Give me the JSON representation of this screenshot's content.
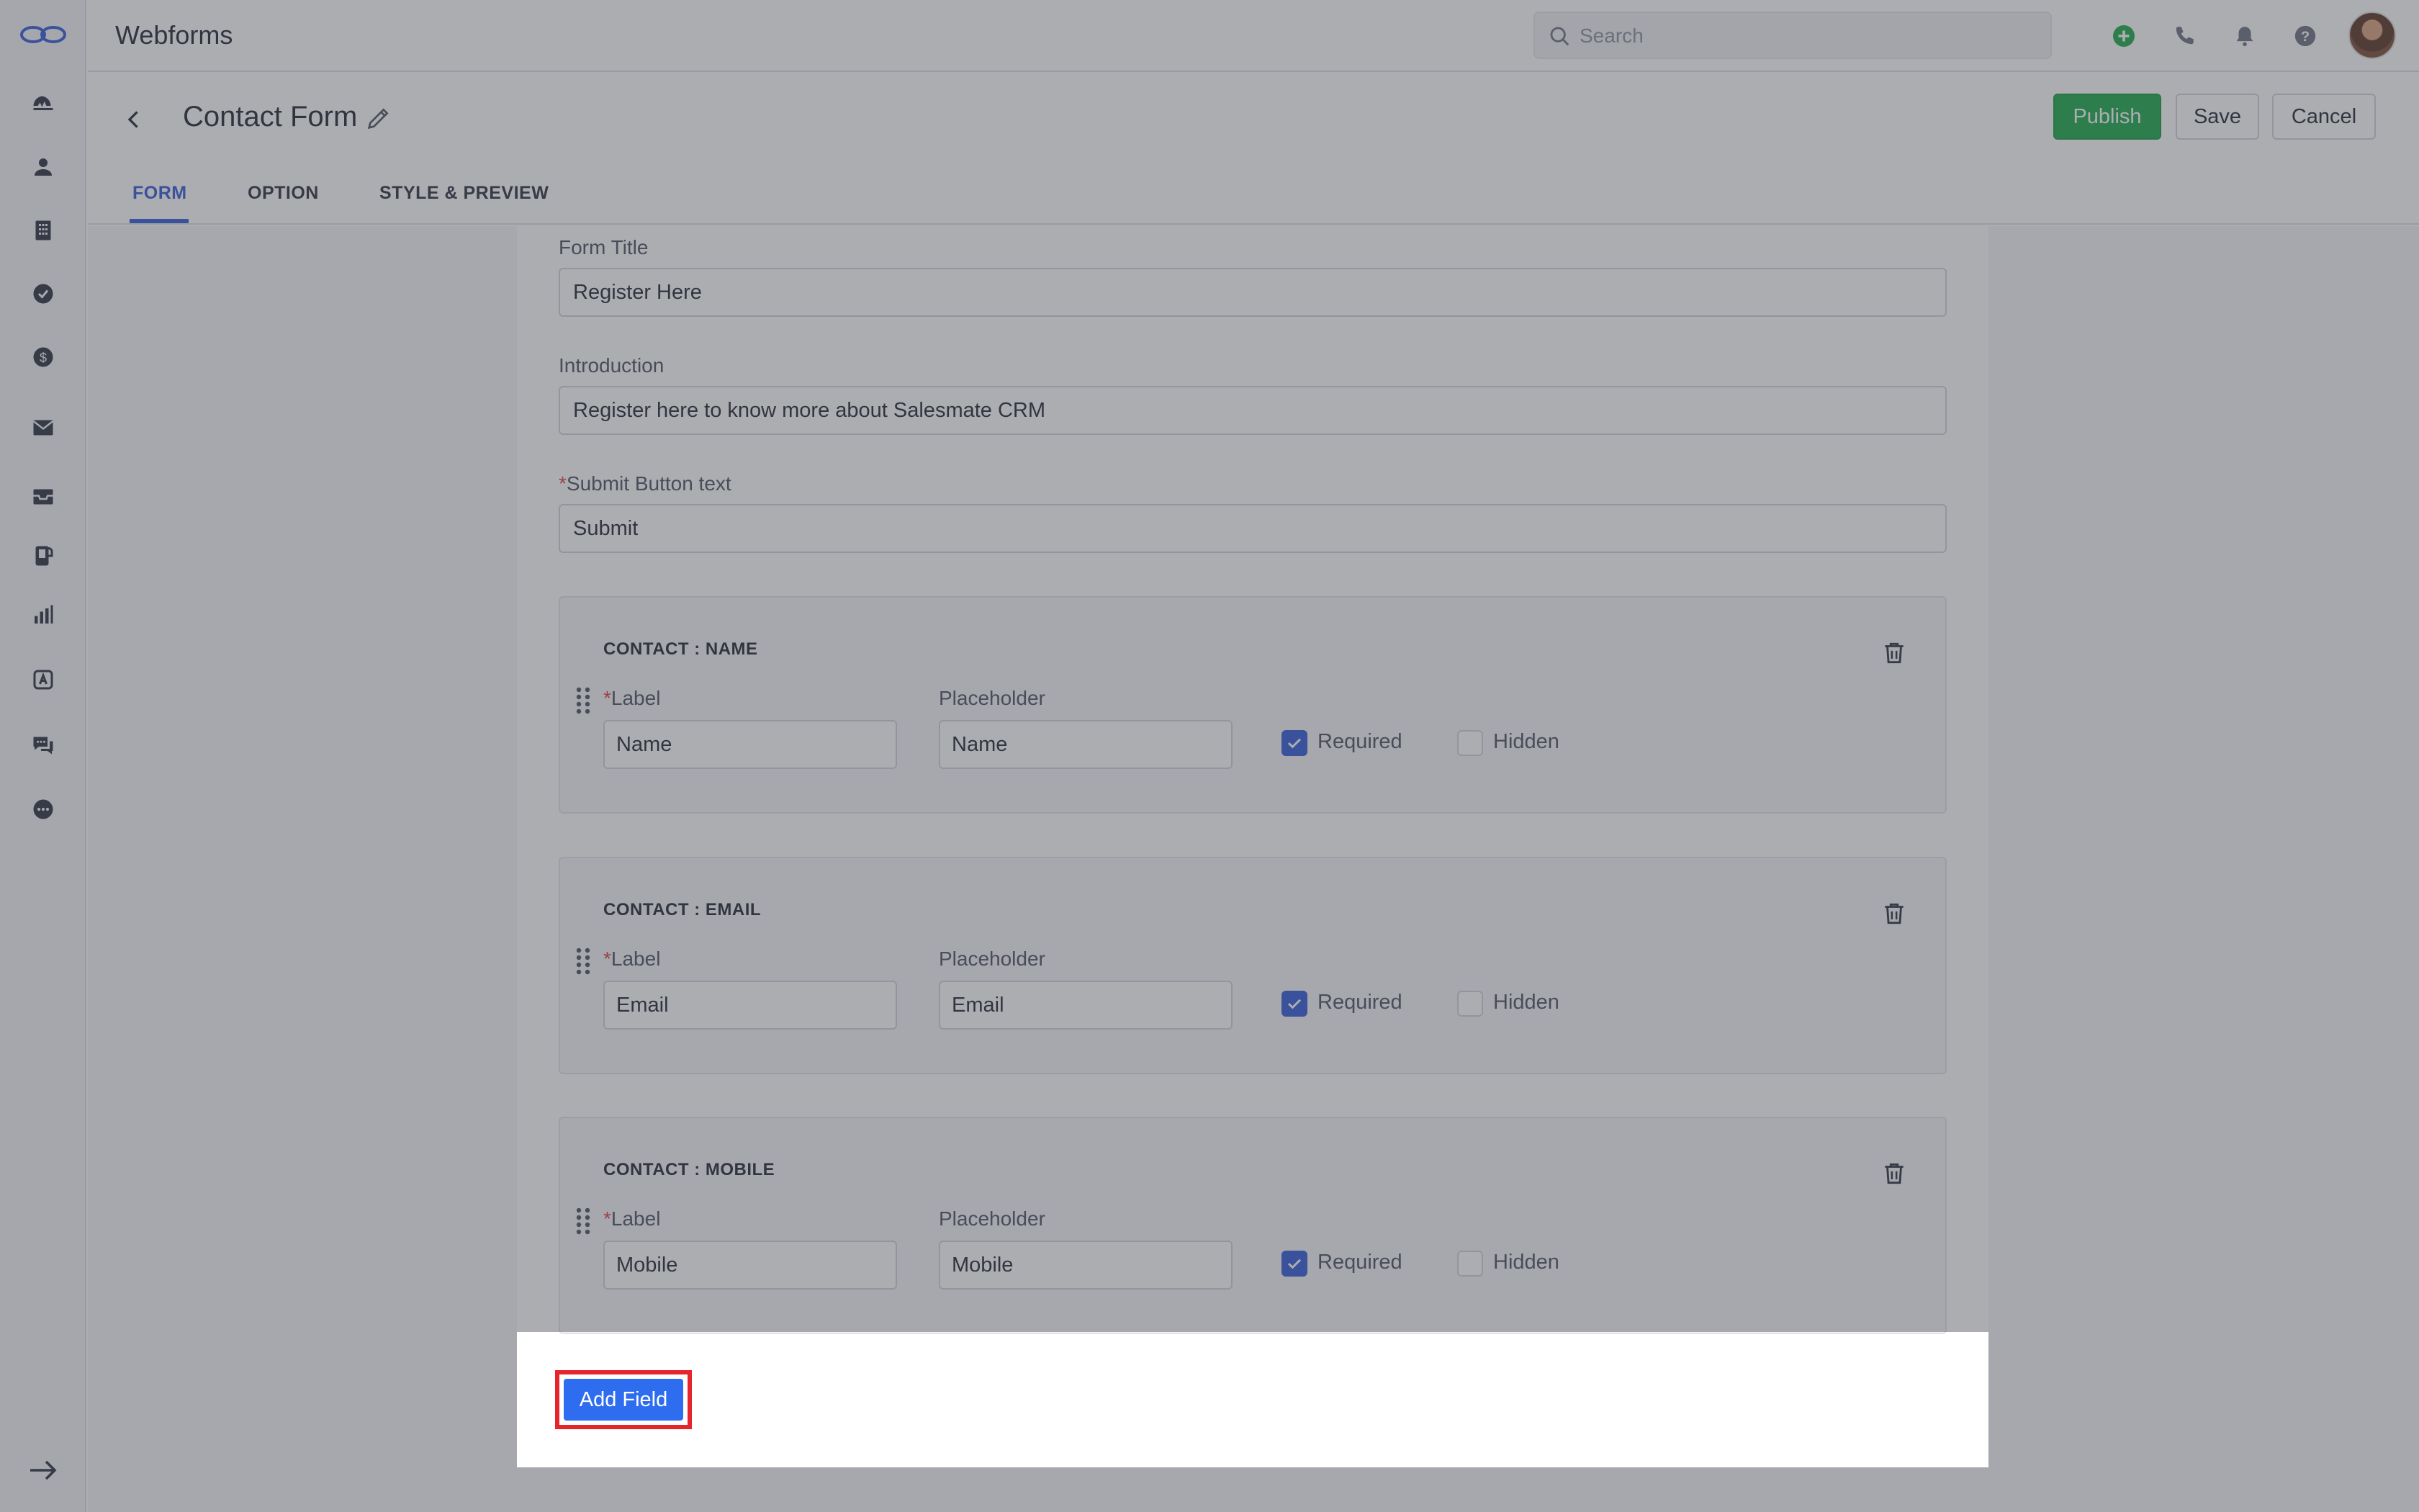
{
  "app": {
    "title": "Webforms"
  },
  "search": {
    "placeholder": "Search"
  },
  "header": {
    "form_name": "Contact Form",
    "publish_label": "Publish",
    "save_label": "Save",
    "cancel_label": "Cancel"
  },
  "tabs": [
    {
      "label": "FORM",
      "active": true
    },
    {
      "label": "OPTION",
      "active": false
    },
    {
      "label": "STYLE & PREVIEW",
      "active": false
    }
  ],
  "form": {
    "title_label": "Form Title",
    "title_value": "Register Here",
    "intro_label": "Introduction",
    "intro_value": "Register here to know more about Salesmate CRM",
    "submit_label": "Submit Button text",
    "submit_value": "Submit"
  },
  "fields": [
    {
      "title": "CONTACT : NAME",
      "label_caption": "Label",
      "placeholder_caption": "Placeholder",
      "label_value": "Name",
      "placeholder_value": "Name",
      "required_label": "Required",
      "required": true,
      "hidden_label": "Hidden",
      "hidden": false
    },
    {
      "title": "CONTACT : EMAIL",
      "label_caption": "Label",
      "placeholder_caption": "Placeholder",
      "label_value": "Email",
      "placeholder_value": "Email",
      "required_label": "Required",
      "required": true,
      "hidden_label": "Hidden",
      "hidden": false
    },
    {
      "title": "CONTACT : MOBILE",
      "label_caption": "Label",
      "placeholder_caption": "Placeholder",
      "label_value": "Mobile",
      "placeholder_value": "Mobile",
      "required_label": "Required",
      "required": true,
      "hidden_label": "Hidden",
      "hidden": false
    }
  ],
  "add_field_label": "Add Field",
  "colors": {
    "primary": "#2e5ad8",
    "publish": "#1aaa4a",
    "highlight": "#e6242b",
    "add_button": "#2e6cf0"
  },
  "sidebar": {
    "icons": [
      "dashboard-icon",
      "contacts-icon",
      "companies-icon",
      "tasks-icon",
      "deals-icon",
      "email-icon",
      "inbox-icon",
      "calls-icon",
      "reports-icon",
      "automation-icon",
      "chat-icon",
      "more-icon"
    ],
    "bottom_icon": "expand-icon"
  }
}
